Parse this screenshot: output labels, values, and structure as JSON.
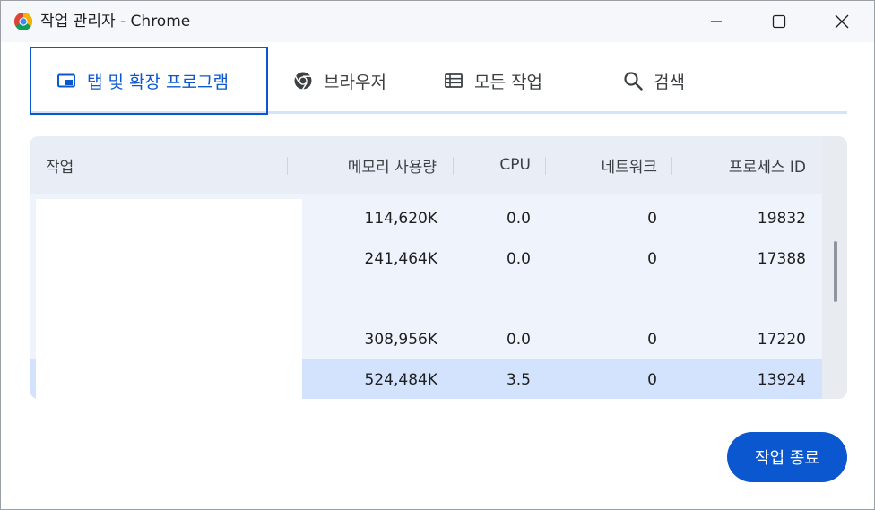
{
  "window": {
    "title": "작업 관리자 - Chrome",
    "app_icon": "chrome-logo-icon",
    "controls": {
      "minimize": "minimize-icon",
      "maximize": "maximize-icon",
      "close": "close-icon"
    }
  },
  "tabs": [
    {
      "label": "탭 및 확장 프로그램",
      "icon": "tab-window-icon",
      "selected": true
    },
    {
      "label": "브라우저",
      "icon": "chrome-icon",
      "selected": false
    },
    {
      "label": "모든 작업",
      "icon": "list-icon",
      "selected": false
    },
    {
      "label": "검색",
      "icon": "search-icon",
      "selected": false
    }
  ],
  "table": {
    "headers": {
      "task": "작업",
      "memory": "메모리 사용량",
      "cpu": "CPU",
      "network": "네트워크",
      "pid": "프로세스 ID"
    },
    "rows": [
      {
        "memory": "114,620K",
        "cpu": "0.0",
        "network": "0",
        "pid": "19832"
      },
      {
        "memory": "241,464K",
        "cpu": "0.0",
        "network": "0",
        "pid": "17388"
      },
      {
        "memory": "",
        "cpu": "",
        "network": "",
        "pid": ""
      },
      {
        "memory": "308,956K",
        "cpu": "0.0",
        "network": "0",
        "pid": "17220"
      },
      {
        "memory": "524,484K",
        "cpu": "3.5",
        "network": "0",
        "pid": "13924",
        "selected": true
      }
    ]
  },
  "actions": {
    "end_task": "작업 종료"
  },
  "colors": {
    "accent": "#0b57d0",
    "selected_row": "#d3e3fd",
    "table_bg": "#eff3fb"
  }
}
